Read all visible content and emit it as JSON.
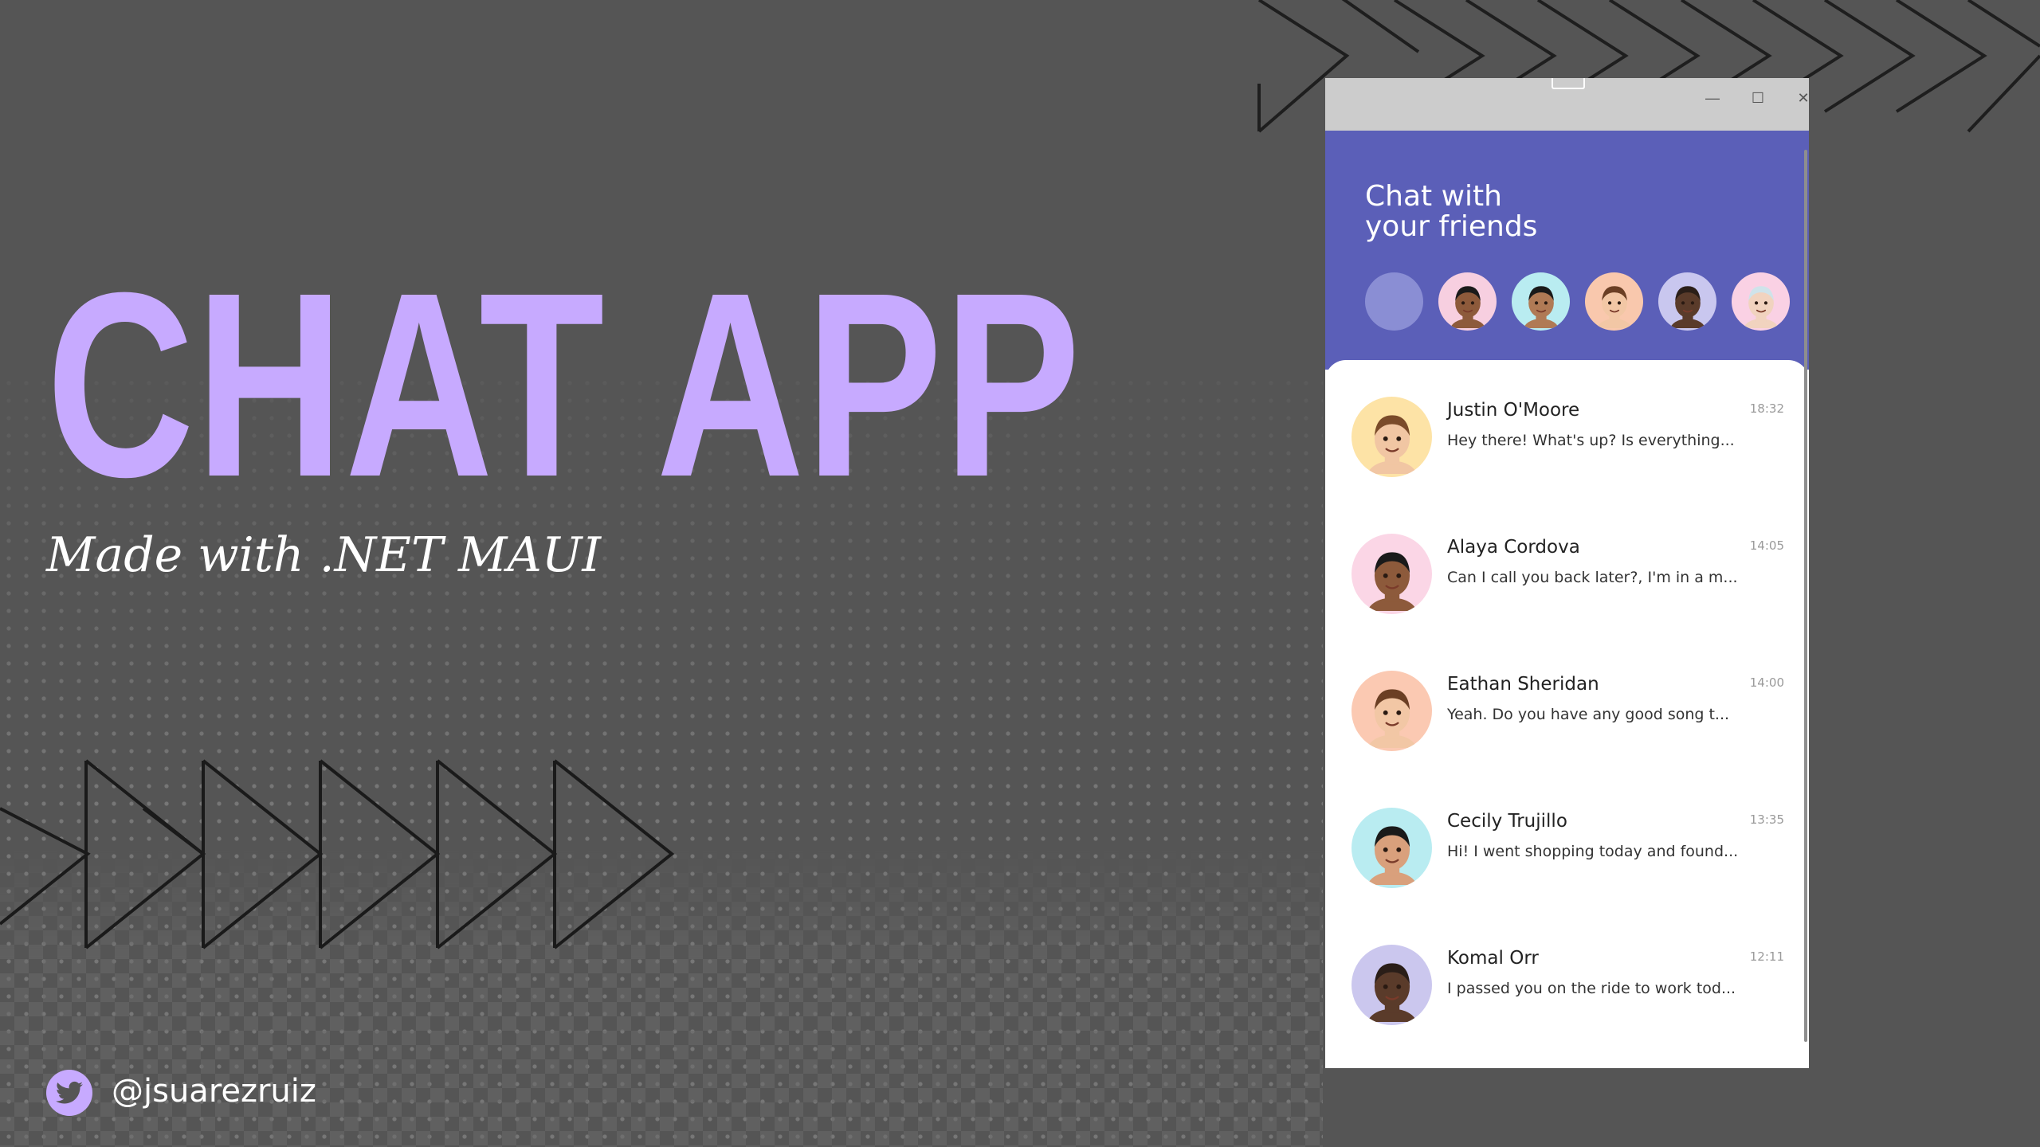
{
  "hero": {
    "title": "CHAT APP",
    "subtitle": "Made with .NET MAUI",
    "handle": "@jsuarezruiz"
  },
  "window": {
    "buttons": {
      "minimize": "—",
      "maximize": "☐",
      "close": "✕"
    }
  },
  "header": {
    "title_line1": "Chat with",
    "title_line2": "your friends"
  },
  "stories": [
    {
      "skin": "#8d5a3b",
      "bg": "#f7cfe0",
      "hair": "#1a1a1a"
    },
    {
      "skin": "#b07a55",
      "bg": "#b9ecf1",
      "hair": "#1a1a1a"
    },
    {
      "skin": "#f2c7a5",
      "bg": "#f9c8ad",
      "hair": "#6b3f24"
    },
    {
      "skin": "#5a3b2a",
      "bg": "#c9c7ef",
      "hair": "#2a1e18"
    },
    {
      "skin": "#f1d3bf",
      "bg": "#fad1e4",
      "hair": "#cfe3ea"
    }
  ],
  "chats": [
    {
      "name": "Justin O'Moore",
      "message": "Hey there! What's up? Is everything...",
      "time": "18:32",
      "bg": "#fde3a6",
      "skin": "#f1c6a3",
      "hair": "#7a4b2a"
    },
    {
      "name": "Alaya Cordova",
      "message": "Can I call you back later?, I'm in a m...",
      "time": "14:05",
      "bg": "#fbd6e6",
      "skin": "#8d5a3b",
      "hair": "#1a1a1a"
    },
    {
      "name": "Eathan Sheridan",
      "message": "Yeah. Do you have any good song t...",
      "time": "14:00",
      "bg": "#fbc9b2",
      "skin": "#f2c7a5",
      "hair": "#6b3f24"
    },
    {
      "name": "Cecily Trujillo",
      "message": "Hi! I went shopping today and found...",
      "time": "13:35",
      "bg": "#b9ecf1",
      "skin": "#d9a07c",
      "hair": "#1a1a1a"
    },
    {
      "name": "Komal Orr",
      "message": "I passed you on the ride to work tod...",
      "time": "12:11",
      "bg": "#cbc7ee",
      "skin": "#5a3b2a",
      "hair": "#2a1e18"
    }
  ],
  "colors": {
    "background": "#555555",
    "accent": "#c7aaff",
    "header": "#5b5fb8",
    "titlebar": "#cccccc"
  }
}
